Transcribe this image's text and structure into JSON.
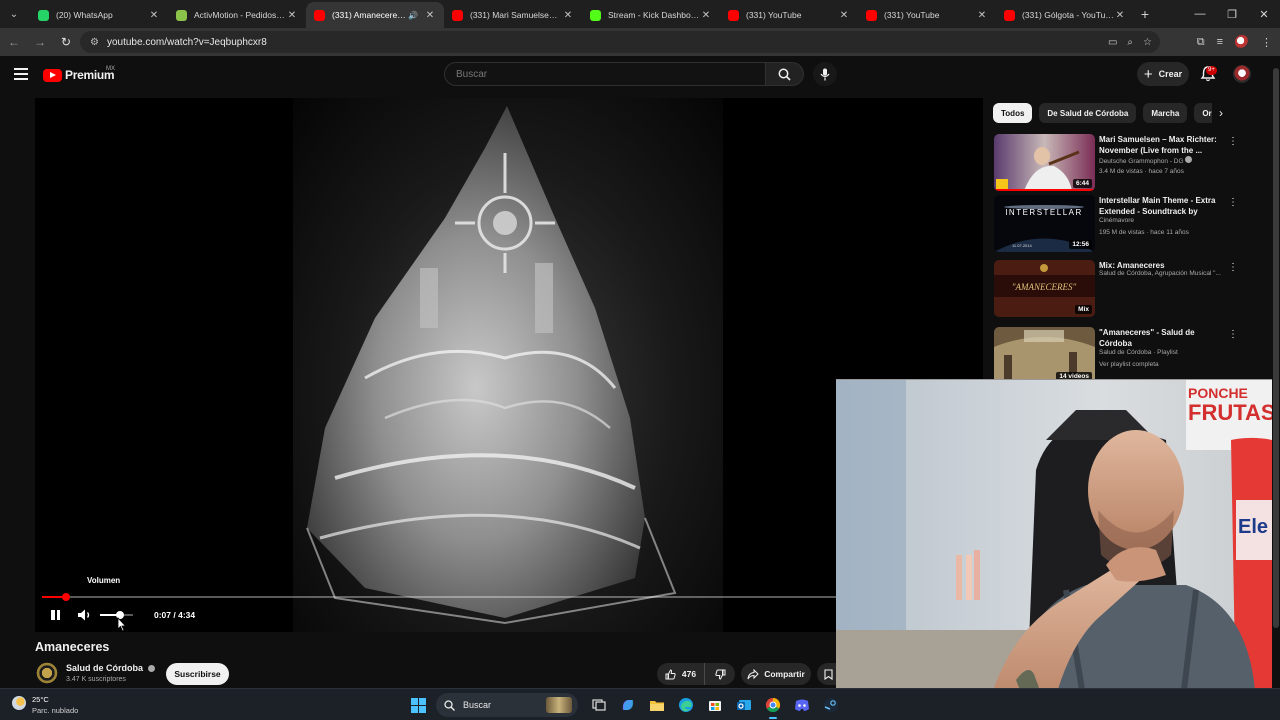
{
  "browser": {
    "tabs": [
      {
        "title": "(20) WhatsApp",
        "color": "#25d366",
        "active": false,
        "audio": false
      },
      {
        "title": "ActivMotion - Pedidos - S",
        "color": "#8bc34a",
        "active": false,
        "audio": false
      },
      {
        "title": "(331) Amaneceres - Y",
        "color": "#ff0000",
        "active": true,
        "audio": true
      },
      {
        "title": "(331) Mari Samuelsen – M",
        "color": "#ff0000",
        "active": false,
        "audio": false
      },
      {
        "title": "Stream - Kick Dashboard",
        "color": "#53fc18",
        "active": false,
        "audio": false
      },
      {
        "title": "(331) YouTube",
        "color": "#ff0000",
        "active": false,
        "audio": false
      },
      {
        "title": "(331) YouTube",
        "color": "#ff0000",
        "active": false,
        "audio": false
      },
      {
        "title": "(331) Gólgota - YouTube",
        "color": "#ff0000",
        "active": false,
        "audio": false
      }
    ],
    "url": "youtube.com/watch?v=Jeqbuphcxr8"
  },
  "masthead": {
    "brand": "Premium",
    "country": "MX",
    "search_placeholder": "Buscar",
    "create_label": "Crear",
    "notifications": "9+"
  },
  "player": {
    "tooltip": "Volumen",
    "time": "0:07 / 4:34",
    "progress_fraction": 0.0255,
    "volume_fraction": 0.6
  },
  "video": {
    "title": "Amaneceres",
    "channel": "Salud de Córdoba",
    "subscribers": "3.47 K suscriptores",
    "subscribe_label": "Suscribirse",
    "likes": "476",
    "share_label": "Compartir"
  },
  "sidebar": {
    "chips": [
      "Todos",
      "De Salud de Córdoba",
      "Marcha",
      "Org"
    ],
    "recommendations": [
      {
        "title": "Mari Samuelsen – Max Richter: November (Live from the ...",
        "channel": "Deutsche Grammophon - DG",
        "meta": "3.4 M de vistas · hace 7 años",
        "badge": "6:44",
        "verified": true,
        "watched": true
      },
      {
        "title": "Interstellar Main Theme - Extra Extended - Soundtrack by  Han...",
        "channel": "Cinémavore",
        "meta": "195 M de vistas · hace 11 años",
        "badge": "12:56",
        "verified": false,
        "watched": false
      },
      {
        "title": "Mix: Amaneceres",
        "channel": "Salud de Córdoba, Agrupación Musical \"...",
        "meta": "",
        "badge": "Mix",
        "verified": false,
        "watched": false
      },
      {
        "title": "\"Amaneceres\" - Salud de Córdoba",
        "channel": "Salud de Córdoba · Playlist",
        "meta": "Ver playlist completa",
        "badge": "14 videos",
        "verified": false,
        "watched": false
      }
    ],
    "thumb_texts": [
      "INTERSTELLAR",
      "11.07.2014",
      "\"AMANECERES\""
    ]
  },
  "webcam": {
    "poster_text": [
      "PONCHE",
      "FRUTAS"
    ],
    "bottle_text": "Ele"
  },
  "taskbar": {
    "temperature": "25°C",
    "weather": "Parc. nublado",
    "search_label": "Buscar"
  }
}
